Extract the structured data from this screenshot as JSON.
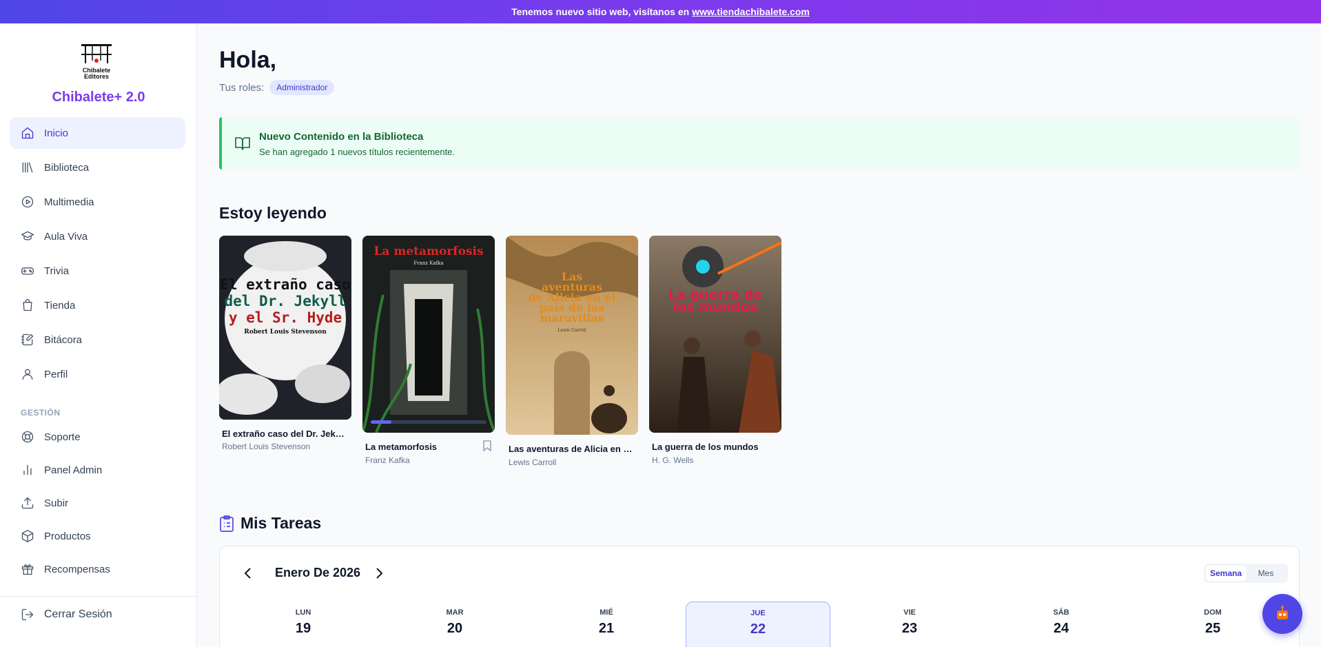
{
  "banner": {
    "text": "Tenemos nuevo sitio web, visítanos en",
    "link": "www.tiendachibalete.com"
  },
  "sidebar": {
    "logo_text": "Chibalete Editores",
    "brand": "Chibalete+ 2.0",
    "items": [
      {
        "label": "Inicio",
        "icon": "home-icon"
      },
      {
        "label": "Biblioteca",
        "icon": "library-icon"
      },
      {
        "label": "Multimedia",
        "icon": "play-icon"
      },
      {
        "label": "Aula Viva",
        "icon": "graduation-cap-icon"
      },
      {
        "label": "Trivia",
        "icon": "gamepad-icon"
      },
      {
        "label": "Tienda",
        "icon": "shopping-bag-icon"
      },
      {
        "label": "Bitácora",
        "icon": "notebook-pen-icon"
      },
      {
        "label": "Perfil",
        "icon": "user-icon"
      }
    ],
    "section_label": "GESTIÓN",
    "admin_items": [
      {
        "label": "Soporte",
        "icon": "lifebuoy-icon"
      },
      {
        "label": "Panel Admin",
        "icon": "bar-chart-icon"
      },
      {
        "label": "Subir",
        "icon": "upload-icon"
      },
      {
        "label": "Productos",
        "icon": "package-icon"
      },
      {
        "label": "Recompensas",
        "icon": "gift-icon"
      }
    ],
    "logout": "Cerrar Sesión"
  },
  "header": {
    "greeting": "Hola,",
    "roles_label": "Tus roles:",
    "role": "Administrador"
  },
  "notice": {
    "title": "Nuevo Contenido en la Biblioteca",
    "subtitle": "Se han agregado 1 nuevos títulos recientemente."
  },
  "reading": {
    "title": "Estoy leyendo",
    "books": [
      {
        "title": "El extraño caso del Dr. Jekyll y el Sr. Hyde",
        "author": "Robert Louis Stevenson",
        "cover_text": [
          "El extraño caso",
          "del Dr. Jekyll",
          "y el Sr. Hyde",
          "Robert Louis Stevenson"
        ]
      },
      {
        "title": "La metamorfosis",
        "author": "Franz Kafka",
        "cover_text": [
          "La metamorfosis",
          "Franz Kafka"
        ],
        "progress": 0.18
      },
      {
        "title": "Las aventuras de Alicia en el país de las maravillas",
        "author": "Lewis Carroll",
        "cover_text": [
          "Las",
          "aventuras",
          "de Alicia en el",
          "país de las",
          "maravillas",
          "Lewis Carroll"
        ]
      },
      {
        "title": "La guerra de los mundos",
        "author": "H. G. Wells",
        "cover_text": [
          "La guerra de",
          "los mundos"
        ]
      }
    ]
  },
  "tasks": {
    "title": "Mis Tareas",
    "month": "Enero De 2026",
    "views": [
      "Semana",
      "Mes"
    ],
    "days": [
      {
        "name": "LUN",
        "num": "19"
      },
      {
        "name": "MAR",
        "num": "20"
      },
      {
        "name": "MIÉ",
        "num": "21"
      },
      {
        "name": "JUE",
        "num": "22"
      },
      {
        "name": "VIE",
        "num": "23"
      },
      {
        "name": "SÁB",
        "num": "24"
      },
      {
        "name": "DOM",
        "num": "25"
      }
    ]
  }
}
